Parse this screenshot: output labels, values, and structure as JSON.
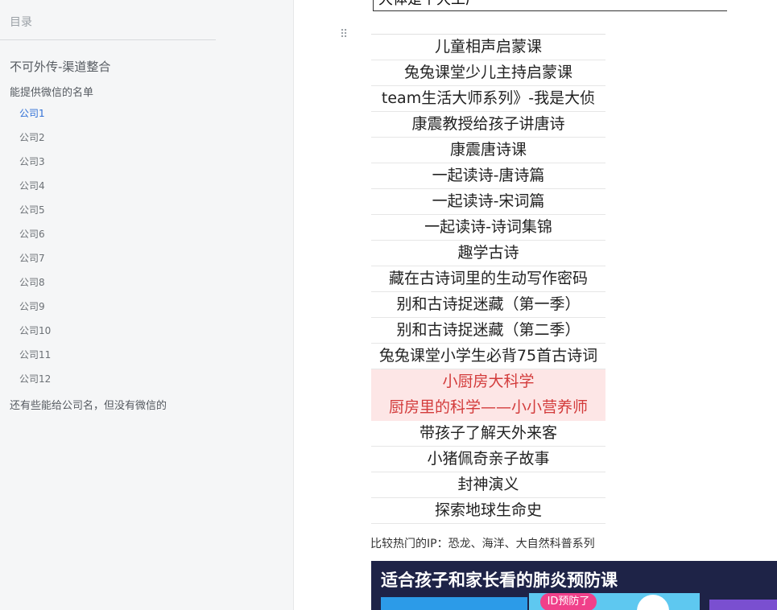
{
  "sidebar": {
    "header": "目录",
    "doc_title": "不可外传-渠道整合",
    "section": "能提供微信的名单",
    "items": [
      "公司1",
      "公司2",
      "公司3",
      "公司4",
      "公司5",
      "公司6",
      "公司7",
      "公司8",
      "公司9",
      "公司10",
      "公司11",
      "公司12"
    ],
    "active_item": "公司1",
    "extra": "还有些能给公司名，但没有微信的"
  },
  "content": {
    "prev_text": "大体是个大工厂",
    "courses": [
      {
        "text": "儿童相声启蒙课",
        "highlight": false
      },
      {
        "text": "兔兔课堂少儿主持启蒙课",
        "highlight": false
      },
      {
        "text": "team生活大师系列》-我是大侦",
        "highlight": false
      },
      {
        "text": "康震教授给孩子讲唐诗",
        "highlight": false
      },
      {
        "text": "康震唐诗课",
        "highlight": false
      },
      {
        "text": "一起读诗-唐诗篇",
        "highlight": false
      },
      {
        "text": "一起读诗-宋词篇",
        "highlight": false
      },
      {
        "text": "一起读诗-诗词集锦",
        "highlight": false
      },
      {
        "text": "趣学古诗",
        "highlight": false
      },
      {
        "text": "藏在古诗词里的生动写作密码",
        "highlight": false
      },
      {
        "text": "别和古诗捉迷藏（第一季）",
        "highlight": false
      },
      {
        "text": "别和古诗捉迷藏（第二季）",
        "highlight": false
      },
      {
        "text": "兔兔课堂小学生必背75首古诗词",
        "highlight": false
      },
      {
        "text": "小厨房大科学",
        "highlight": true
      },
      {
        "text": "厨房里的科学——小小营养师",
        "highlight": true
      },
      {
        "text": "带孩子了解天外来客",
        "highlight": false
      },
      {
        "text": "小猪佩奇亲子故事",
        "highlight": false
      },
      {
        "text": "封神演义",
        "highlight": false
      },
      {
        "text": "探索地球生命史",
        "highlight": false
      }
    ],
    "caption": "比较热门的IP：恐龙、海洋、大自然科普系列",
    "banner": {
      "title": "适合孩子和家长看的肺炎预防课",
      "badge": "ID预防了"
    }
  },
  "colors": {
    "sidebar_bg": "#f5f6f7",
    "active_link": "#2f6fd6",
    "highlight_bg": "#fde6e6",
    "highlight_text": "#d33b3b",
    "banner_bg": "#1e2347"
  }
}
